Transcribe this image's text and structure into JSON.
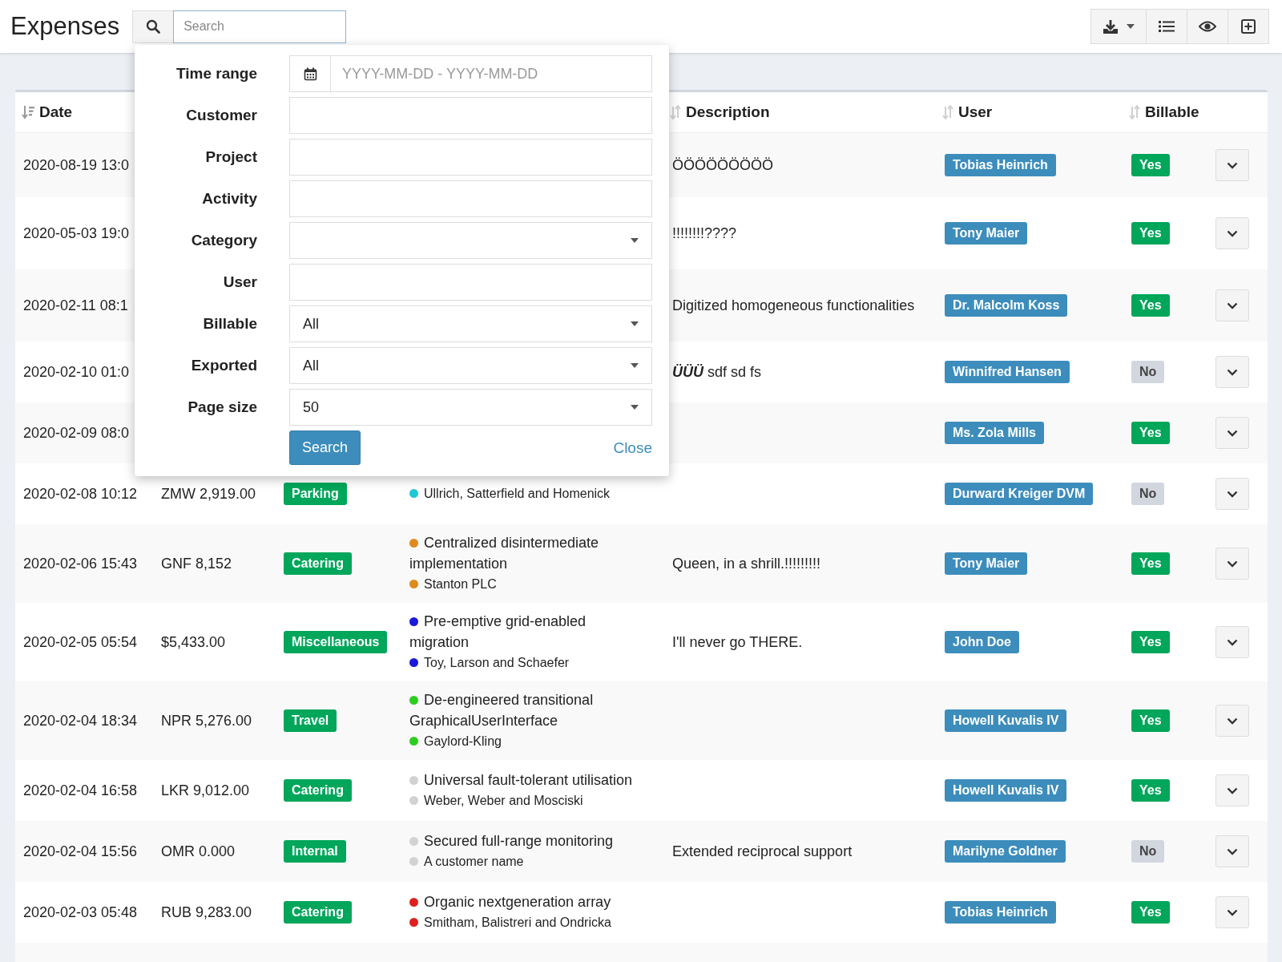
{
  "header": {
    "title": "Expenses",
    "search": {
      "placeholder": "Search"
    },
    "toolbar": [
      {
        "kind": "download"
      },
      {
        "kind": "list"
      },
      {
        "kind": "visibility"
      },
      {
        "kind": "create"
      }
    ]
  },
  "filter": {
    "fields": [
      {
        "label": "Time range",
        "kind": "daterange",
        "placeholder": "YYYY-MM-DD - YYYY-MM-DD"
      },
      {
        "label": "Customer",
        "kind": "text"
      },
      {
        "label": "Project",
        "kind": "text"
      },
      {
        "label": "Activity",
        "kind": "text"
      },
      {
        "label": "Category",
        "kind": "select"
      },
      {
        "label": "User",
        "kind": "text"
      },
      {
        "label": "Billable",
        "kind": "select",
        "value": "All"
      },
      {
        "label": "Exported",
        "kind": "select",
        "value": "All"
      },
      {
        "label": "Page size",
        "kind": "select",
        "value": "50"
      }
    ],
    "search_button": "Search",
    "close_link": "Close"
  },
  "table": {
    "columns": [
      {
        "label": "Date",
        "sorted": true
      },
      {
        "label": "Description",
        "sorted": false
      },
      {
        "label": "User",
        "sorted": false
      },
      {
        "label": "Billable",
        "sorted": false
      }
    ],
    "rows": [
      {
        "date": "2020-08-19 13:0",
        "description": "ÖÖÖÖÖÖÖÖÖ",
        "user": "Tobias Heinrich",
        "billable": true,
        "billable_label": "Yes"
      },
      {
        "date": "2020-05-03 19:0",
        "description": "!!!!!!!!????",
        "user": "Tony Maier",
        "billable": true,
        "billable_label": "Yes"
      },
      {
        "date": "2020-02-11 08:1",
        "description": "Digitized homogeneous functionalities",
        "user": "Dr. Malcolm Koss",
        "billable": true,
        "billable_label": "Yes"
      },
      {
        "date": "2020-02-10 01:0",
        "description": "**ÜÜÜ** sdf sd fs",
        "user": "Winnifred Hansen",
        "billable": false,
        "billable_label": "No"
      },
      {
        "date": "2020-02-09 08:0",
        "user": "Ms. Zola Mills",
        "billable": true,
        "billable_label": "Yes"
      },
      {
        "date": "2020-02-08 10:12",
        "amount": "ZMW 2,919.00",
        "category": "Parking",
        "project": {
          "customer": "Ullrich, Satterfield and Homenick",
          "color": "#1ec8d4"
        },
        "user": "Durward Kreiger DVM",
        "billable": false,
        "billable_label": "No"
      },
      {
        "date": "2020-02-06 15:43",
        "amount": "GNF 8,152",
        "category": "Catering",
        "project": {
          "name": "Centralized disintermediate implementation",
          "customer": "Stanton PLC",
          "color": "#e08a1e"
        },
        "description": "Queen, in a shrill.!!!!!!!!!",
        "user": "Tony Maier",
        "billable": true,
        "billable_label": "Yes"
      },
      {
        "date": "2020-02-05 05:54",
        "amount": "$5,433.00",
        "category": "Miscellaneous",
        "project": {
          "name": "Pre-emptive grid-enabled migration",
          "customer": "Toy, Larson and Schaefer",
          "color": "#1a1adb"
        },
        "description": "I'll never go THERE.",
        "user": "John Doe",
        "billable": true,
        "billable_label": "Yes"
      },
      {
        "date": "2020-02-04 18:34",
        "amount": "NPR 5,276.00",
        "category": "Travel",
        "project": {
          "name": "De-engineered transitional GraphicalUserInterface",
          "customer": "Gaylord-Kling",
          "color": "#2ecc1e"
        },
        "user": "Howell Kuvalis IV",
        "billable": true,
        "billable_label": "Yes"
      },
      {
        "date": "2020-02-04 16:58",
        "amount": "LKR 9,012.00",
        "category": "Catering",
        "project": {
          "name": "Universal fault-tolerant utilisation",
          "customer": "Weber, Weber and Mosciski",
          "color": "#d2d2d2"
        },
        "user": "Howell Kuvalis IV",
        "billable": true,
        "billable_label": "Yes"
      },
      {
        "date": "2020-02-04 15:56",
        "amount": "OMR 0.000",
        "category": "Internal",
        "project": {
          "name": "Secured full-range monitoring",
          "customer": "A customer name",
          "color": "#d2d2d2"
        },
        "description": "Extended reciprocal support",
        "user": "Marilyne Goldner",
        "billable": false,
        "billable_label": "No"
      },
      {
        "date": "2020-02-03 05:48",
        "amount": "RUB 9,283.00",
        "category": "Catering",
        "project": {
          "name": "Organic nextgeneration array",
          "customer": "Smitham, Balistreri and Ondricka",
          "color": "#e0201e"
        },
        "user": "Tobias Heinrich",
        "billable": true,
        "billable_label": "Yes"
      }
    ]
  }
}
